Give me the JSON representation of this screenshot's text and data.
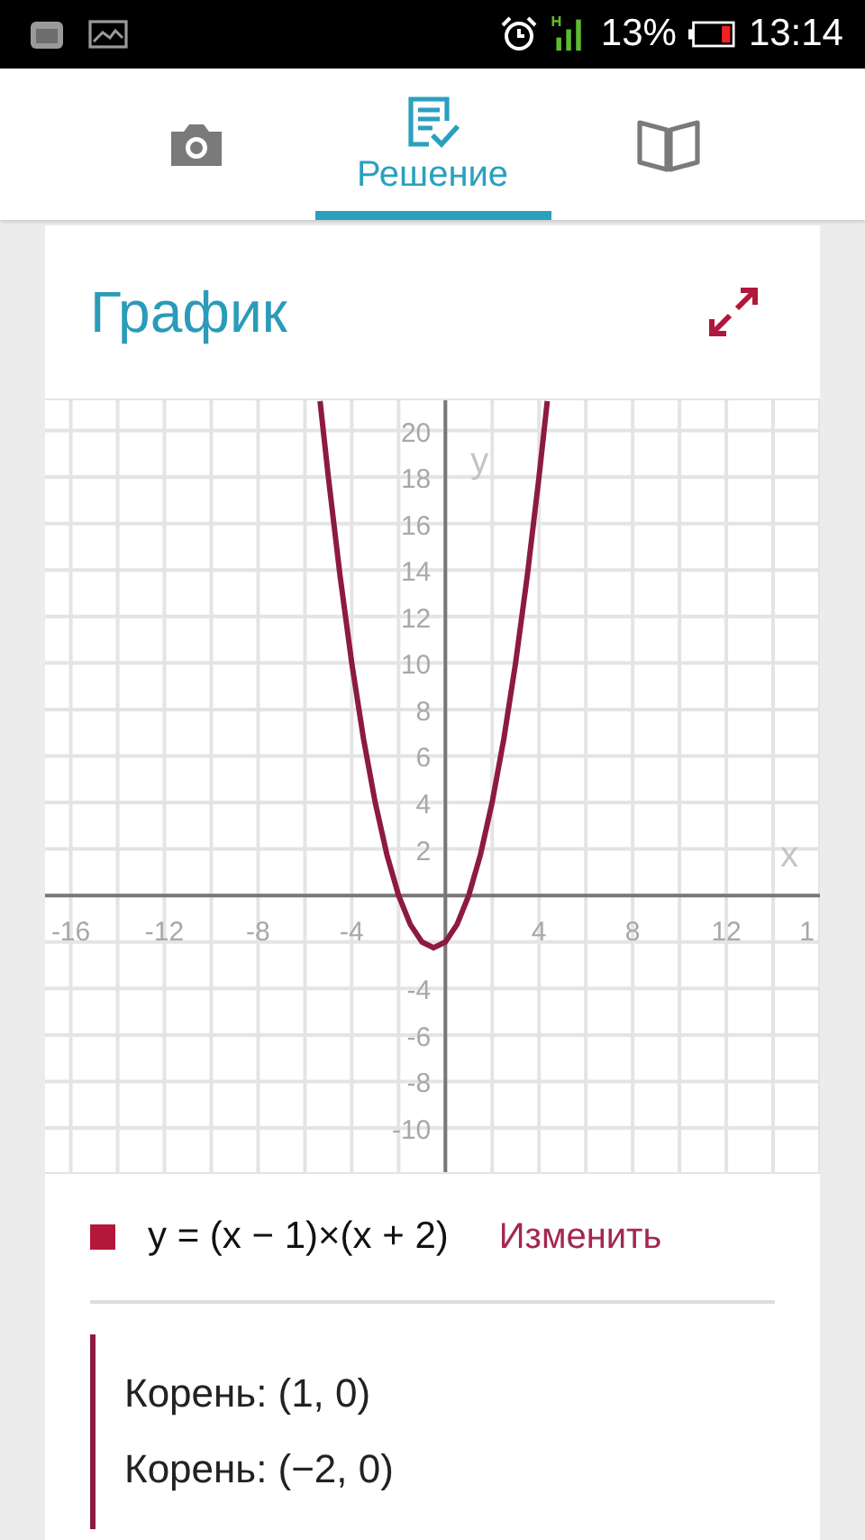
{
  "status_bar": {
    "battery": "13%",
    "time": "13:14"
  },
  "tabs": [
    {
      "kind": "camera",
      "selected": false
    },
    {
      "kind": "solution",
      "label": "Решение",
      "selected": true
    },
    {
      "kind": "book",
      "selected": false
    }
  ],
  "card": {
    "title": "График",
    "chart_data": {
      "type": "line",
      "xlabel": "x",
      "ylabel": "y",
      "xlim": [
        -17.1,
        16
      ],
      "ylim": [
        -11.9,
        21.3
      ],
      "x": [
        -5.35,
        -5,
        -4.5,
        -4,
        -3.5,
        -3,
        -2.5,
        -2,
        -1.5,
        -1,
        -0.5,
        0,
        0.5,
        1,
        1.5,
        2,
        2.5,
        3,
        3.5,
        4,
        4.35
      ],
      "series": [
        {
          "name": "y = (x − 1)×(x + 2)",
          "color": "#8c1a42",
          "values": [
            21.27,
            18,
            13.75,
            10,
            6.75,
            4,
            1.75,
            0,
            -1.25,
            -2,
            -2.25,
            -2,
            -1.25,
            0,
            1.75,
            4,
            6.75,
            10,
            13.75,
            18,
            21.27
          ]
        }
      ],
      "xticks": [
        -16,
        -12,
        -8,
        -4,
        4,
        8,
        12
      ],
      "yticks": [
        20,
        18,
        16,
        14,
        12,
        10,
        8,
        6,
        4,
        2,
        -4,
        -6,
        -8,
        -10
      ],
      "grid": true
    },
    "cut_edge_label": "1",
    "legend": {
      "color": "#b5173c",
      "edit_link": "Изменить"
    },
    "roots": [
      {
        "label": "Корень:",
        "value": "(1, 0)"
      },
      {
        "label": "Корень:",
        "value": "(−2, 0)"
      }
    ]
  }
}
